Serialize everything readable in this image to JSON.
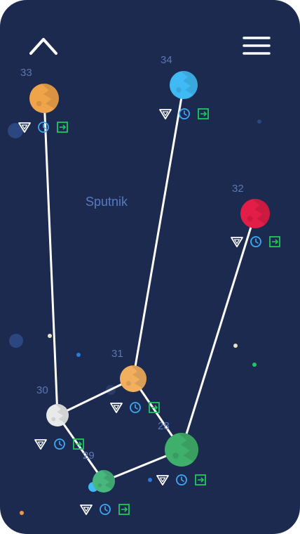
{
  "theme": {
    "background": "#1b2a4e",
    "path_color": "#ffffff",
    "label_color": "#5d76b4",
    "stars_icon_color": "#ffffff",
    "clock_icon_color": "#3fa9f5",
    "exit_icon_color": "#22c55e"
  },
  "header": {
    "back_icon": "chevron-up-icon",
    "menu_icon": "hamburger-menu-icon"
  },
  "region_label": "Sputnik",
  "levels": [
    {
      "number": "28",
      "color": "#3fb06b",
      "status_icons": [
        "rank-triangle-icon",
        "clock-icon",
        "exit-icon"
      ]
    },
    {
      "number": "29",
      "color": "#48b77d",
      "status_icons": [
        "rank-triangle-icon",
        "clock-icon",
        "exit-icon"
      ]
    },
    {
      "number": "30",
      "color": "#e8eaea",
      "status_icons": [
        "rank-triangle-icon",
        "clock-icon",
        "exit-icon"
      ]
    },
    {
      "number": "31",
      "color": "#f2b05f",
      "status_icons": [
        "rank-triangle-icon",
        "clock-icon",
        "exit-icon"
      ]
    },
    {
      "number": "32",
      "color": "#e11d48",
      "status_icons": [
        "rank-triangle-icon",
        "clock-icon",
        "exit-icon"
      ]
    },
    {
      "number": "33",
      "color": "#f0a449",
      "status_icons": [
        "rank-triangle-icon",
        "clock-icon",
        "exit-icon"
      ]
    },
    {
      "number": "34",
      "color": "#3fbaf5",
      "status_icons": [
        "rank-triangle-icon",
        "clock-icon",
        "exit-icon"
      ]
    }
  ]
}
